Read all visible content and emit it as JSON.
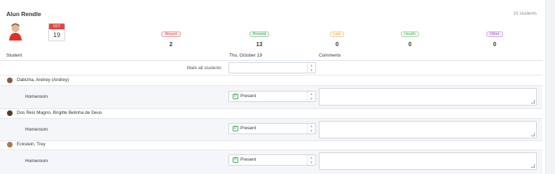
{
  "header": {
    "teacher_name": "Alun Rendle",
    "student_count": "15 students",
    "date_month": "OCT",
    "date_day": "19"
  },
  "stats": [
    {
      "label": "Absent",
      "count": "2",
      "color": "#d9534f",
      "bg": "#fdecec"
    },
    {
      "label": "Present",
      "count": "13",
      "color": "#3aa655",
      "bg": "#eaf7ec"
    },
    {
      "label": "Late",
      "count": "0",
      "color": "#f0ad4e",
      "bg": "#fff6e8"
    },
    {
      "label": "Health",
      "count": "0",
      "color": "#5cb85c",
      "bg": "#f0f9ef"
    },
    {
      "label": "Other",
      "count": "0",
      "color": "#9b59b6",
      "bg": "#f6eefa"
    }
  ],
  "table": {
    "col_student": "Student",
    "col_date": "Thu, October 19",
    "col_comments": "Comments",
    "mark_all_label": "Mark all students",
    "mark_all_value": ""
  },
  "students": [
    {
      "name": "Dabizha, Andrey (Andrey)",
      "avatar_color": "#8b5a3c",
      "period": "Homeroom",
      "status_code": "P",
      "status": "Present",
      "comment": ""
    },
    {
      "name": "Dos Reis Magno, Brigitte Belinha de Deus",
      "avatar_color": "#5a3a28",
      "period": "Homeroom",
      "status_code": "P",
      "status": "Present",
      "comment": ""
    },
    {
      "name": "Eckstein, Trey",
      "avatar_color": "#a8784e",
      "period": "Homeroom",
      "status_code": "P",
      "status": "Present",
      "comment": ""
    }
  ]
}
